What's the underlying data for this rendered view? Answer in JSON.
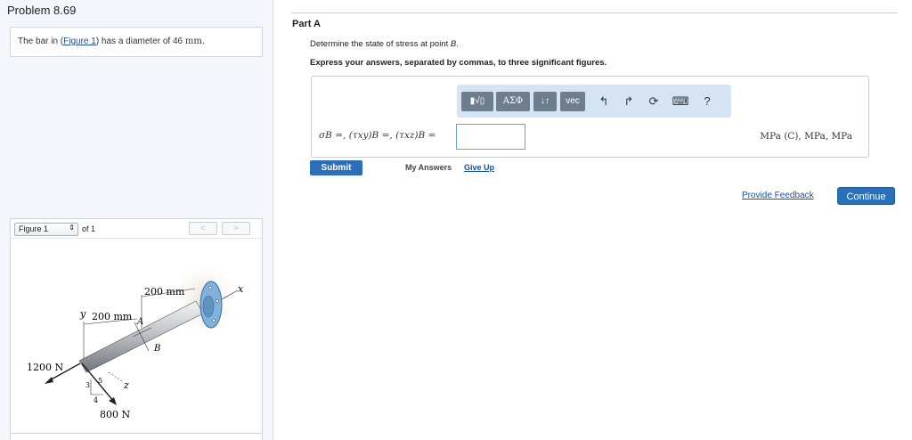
{
  "problem": {
    "title": "Problem 8.69",
    "intro_before": "The bar in (",
    "intro_link": "Figure 1",
    "intro_after": ") has a diameter of 46",
    "intro_unit": "mm."
  },
  "figure": {
    "select_label": "Figure 1",
    "of_text": "of 1",
    "prev": "<",
    "next": ">",
    "labels": {
      "dim1": "200 mm",
      "dim2": "200 mm",
      "y": "y",
      "x": "x",
      "z": "z",
      "a": "A",
      "b": "B",
      "force_h": "1200 N",
      "force_v": "800 N",
      "t3": "3",
      "t4": "4",
      "t5": "5"
    }
  },
  "part": {
    "label": "Part A",
    "question_before": "Determine the state of stress at point ",
    "question_point": "B",
    "question_after": ".",
    "instruction": "Express your answers, separated by commas, to three significant figures."
  },
  "toolbar": {
    "template": "▮√▯",
    "greek": "ΑΣΦ",
    "arrows": "↓↑",
    "vec": "vec",
    "undo": "↰",
    "redo": "↱",
    "reset": "⟳",
    "keyboard": "⌨",
    "help": "?"
  },
  "answer": {
    "equation": "σB =, (τxy)B =, (τxz)B =",
    "value": "",
    "units": "MPa (C), MPa, MPa"
  },
  "actions": {
    "submit": "Submit",
    "my_answers": "My Answers",
    "give_up": "Give Up",
    "feedback": "Provide Feedback",
    "continue": "Continue"
  }
}
